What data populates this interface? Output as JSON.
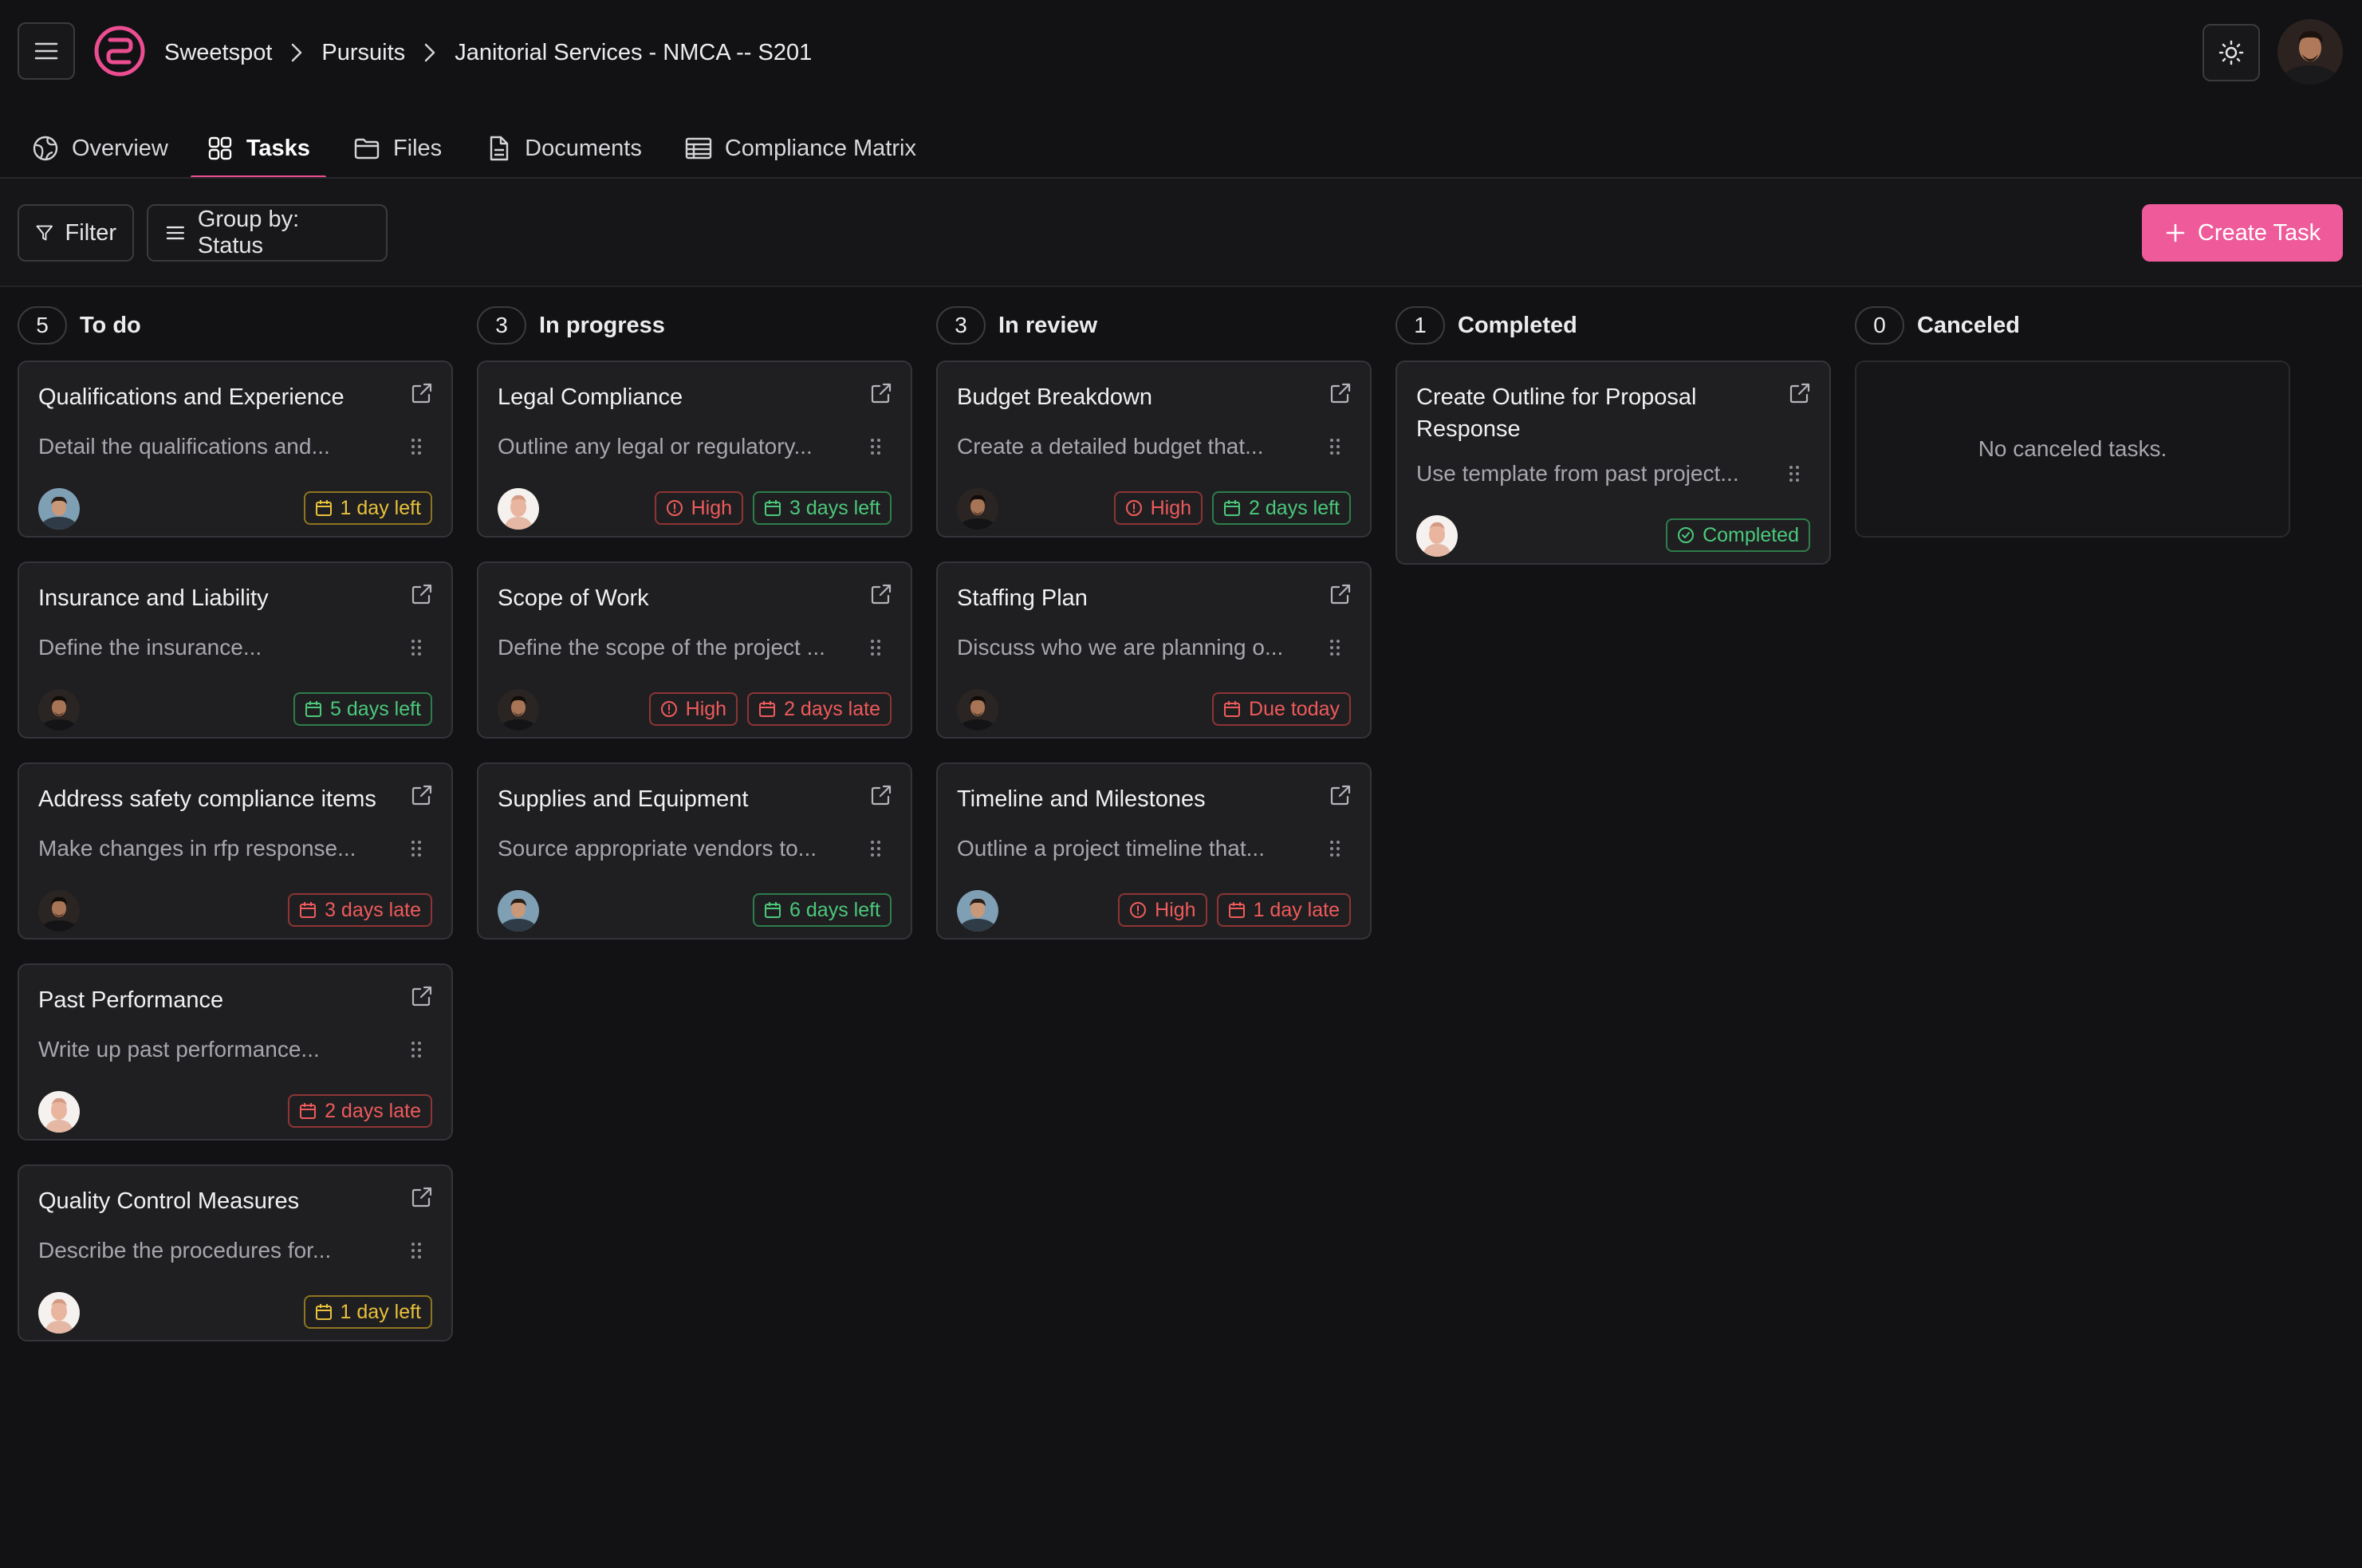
{
  "header": {
    "breadcrumb": [
      "Sweetspot",
      "Pursuits",
      "Janitorial Services - NMCA -- S201"
    ]
  },
  "tabs": [
    {
      "label": "Overview",
      "icon": "globe-icon",
      "active": false
    },
    {
      "label": "Tasks",
      "icon": "grid-icon",
      "active": true
    },
    {
      "label": "Files",
      "icon": "folder-icon",
      "active": false
    },
    {
      "label": "Documents",
      "icon": "document-icon",
      "active": false
    },
    {
      "label": "Compliance Matrix",
      "icon": "table-icon",
      "active": false
    }
  ],
  "toolbar": {
    "filter_label": "Filter",
    "group_label": "Group by: Status",
    "create_label": "Create Task"
  },
  "colors": {
    "accent": "#ef5a9a",
    "badge_yellow": "#e9c13b",
    "badge_green": "#4bc97a",
    "badge_red": "#ef5a5a"
  },
  "columns": [
    {
      "count": "5",
      "title": "To do",
      "cards": [
        {
          "title": "Qualifications and Experience",
          "desc": "Detail the qualifications and...",
          "avatar": "avatar-blue",
          "badges": [
            {
              "text": "1 day left",
              "color": "yellow",
              "icon": "calendar"
            }
          ]
        },
        {
          "title": "Insurance and Liability",
          "desc": "Define the insurance...",
          "avatar": "avatar-dark",
          "badges": [
            {
              "text": "5 days left",
              "color": "green",
              "icon": "calendar"
            }
          ]
        },
        {
          "title": "Address safety compliance items",
          "desc": "Make changes in rfp response...",
          "avatar": "avatar-dark",
          "badges": [
            {
              "text": "3 days late",
              "color": "red",
              "icon": "calendar"
            }
          ]
        },
        {
          "title": "Past Performance",
          "desc": "Write up past performance...",
          "avatar": "avatar-light",
          "badges": [
            {
              "text": "2 days late",
              "color": "red",
              "icon": "calendar"
            }
          ]
        },
        {
          "title": "Quality Control Measures",
          "desc": "Describe the procedures for...",
          "avatar": "avatar-light",
          "badges": [
            {
              "text": "1 day left",
              "color": "yellow",
              "icon": "calendar"
            }
          ]
        }
      ]
    },
    {
      "count": "3",
      "title": "In progress",
      "cards": [
        {
          "title": "Legal Compliance",
          "desc": "Outline any legal or regulatory...",
          "avatar": "avatar-light",
          "badges": [
            {
              "text": "High",
              "color": "red",
              "icon": "alert"
            },
            {
              "text": "3 days left",
              "color": "green",
              "icon": "calendar"
            }
          ]
        },
        {
          "title": "Scope of Work",
          "desc": "Define the scope of the project ...",
          "avatar": "avatar-dark",
          "badges": [
            {
              "text": "High",
              "color": "red",
              "icon": "alert"
            },
            {
              "text": "2 days late",
              "color": "red",
              "icon": "calendar"
            }
          ]
        },
        {
          "title": "Supplies and Equipment",
          "desc": "Source appropriate vendors to...",
          "avatar": "avatar-blue",
          "badges": [
            {
              "text": "6 days left",
              "color": "green",
              "icon": "calendar"
            }
          ]
        }
      ]
    },
    {
      "count": "3",
      "title": "In review",
      "cards": [
        {
          "title": "Budget Breakdown",
          "desc": "Create a detailed budget that...",
          "avatar": "avatar-dark",
          "badges": [
            {
              "text": "High",
              "color": "red",
              "icon": "alert"
            },
            {
              "text": "2 days left",
              "color": "green",
              "icon": "calendar"
            }
          ]
        },
        {
          "title": "Staffing Plan",
          "desc": "Discuss who we are planning o...",
          "avatar": "avatar-dark",
          "badges": [
            {
              "text": "Due today",
              "color": "red",
              "icon": "calendar"
            }
          ]
        },
        {
          "title": "Timeline and Milestones",
          "desc": "Outline a project timeline that...",
          "avatar": "avatar-blue",
          "badges": [
            {
              "text": "High",
              "color": "red",
              "icon": "alert"
            },
            {
              "text": "1 day late",
              "color": "red",
              "icon": "calendar"
            }
          ]
        }
      ]
    },
    {
      "count": "1",
      "title": "Completed",
      "cards": [
        {
          "title": "Create Outline for Proposal Response",
          "desc": "Use template from past project...",
          "avatar": "avatar-light",
          "tall": true,
          "badges": [
            {
              "text": "Completed",
              "color": "green",
              "icon": "check"
            }
          ]
        }
      ]
    },
    {
      "count": "0",
      "title": "Canceled",
      "cards": [],
      "empty_text": "No canceled tasks."
    }
  ]
}
